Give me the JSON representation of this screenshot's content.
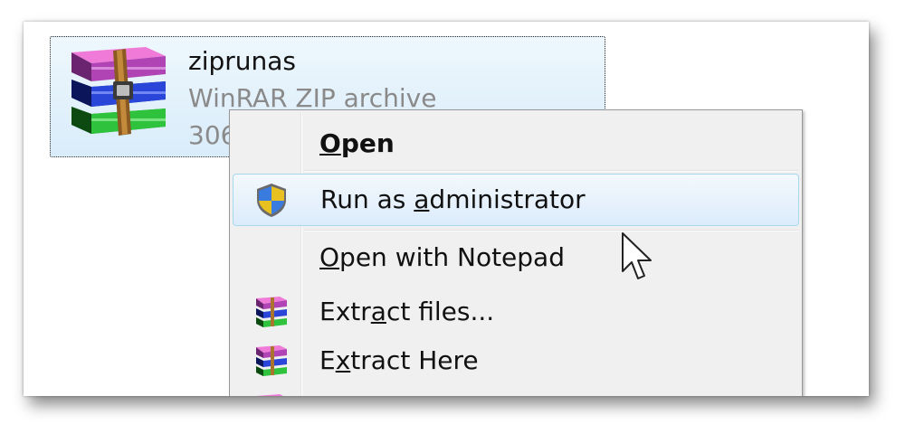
{
  "file": {
    "name": "ziprunas",
    "type": "WinRAR ZIP archive",
    "size_visible": "306",
    "icon": "winrar-archive-icon"
  },
  "context_menu": {
    "items": [
      {
        "label": "Open",
        "underline": "O",
        "bold": true,
        "icon": null
      },
      {
        "label": "Run as administrator",
        "underline": "a",
        "icon": "uac-shield-icon",
        "highlighted": true
      },
      {
        "label": "Open with Notepad",
        "underline": "O",
        "icon": null
      },
      {
        "label": "Extract files...",
        "underline": "a",
        "icon": "winrar-small-icon"
      },
      {
        "label": "Extract Here",
        "underline": "x",
        "icon": "winrar-small-icon"
      }
    ]
  },
  "colors": {
    "selection_fill": "#d9ecfa",
    "menu_background": "#f0f0f0",
    "hover_border": "#a8d8eb",
    "secondary_text": "#8a8a8a"
  }
}
